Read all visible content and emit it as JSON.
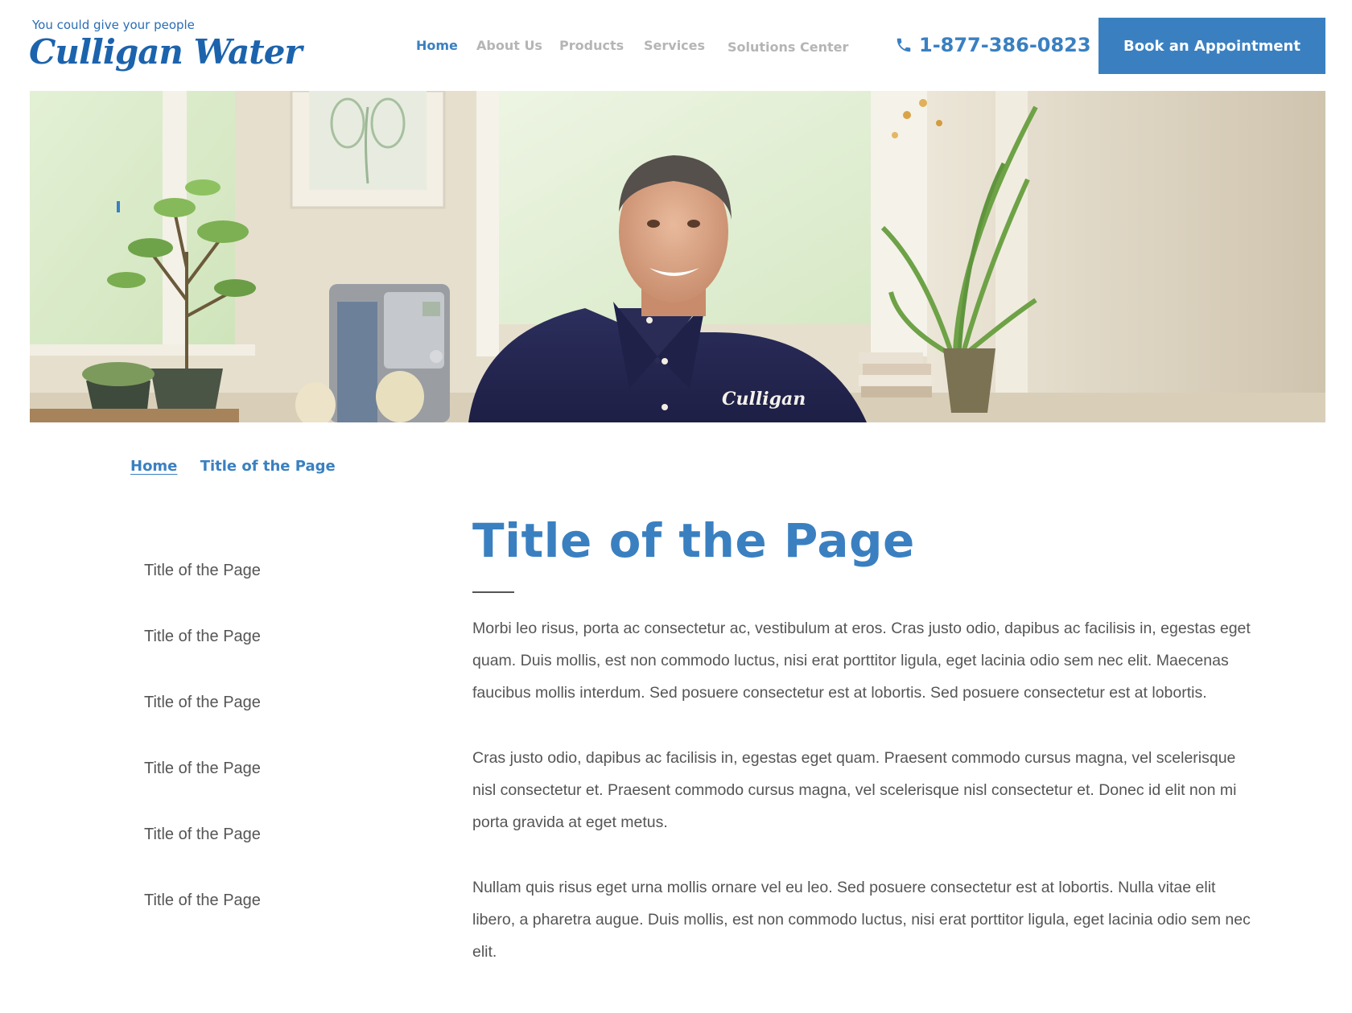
{
  "header": {
    "logo": {
      "tagline": "You could give your people",
      "wordmark": "Culligan Water",
      "trademark": "®"
    },
    "nav": {
      "home": "Home",
      "about": "About Us",
      "products": "Products",
      "services": "Services",
      "solutions": "Solutions Center"
    },
    "phone": "1-877-386-0823",
    "cta_label": "Book an Appointment"
  },
  "hero": {
    "shirt_logo": "Culligan"
  },
  "breadcrumb": {
    "home": "Home",
    "current": "Title of the Page"
  },
  "sidebar": {
    "items": [
      {
        "label": "Title of the Page"
      },
      {
        "label": "Title of the Page"
      },
      {
        "label": "Title of the Page"
      },
      {
        "label": "Title of the Page"
      },
      {
        "label": "Title of the Page"
      },
      {
        "label": "Title of the Page"
      }
    ]
  },
  "main": {
    "title": "Title of the Page",
    "paragraphs": [
      "Morbi leo risus, porta ac consectetur ac, vestibulum at eros. Cras justo odio, dapibus ac facilisis in, egestas eget quam. Duis mollis, est non commodo luctus, nisi erat porttitor ligula, eget lacinia odio sem nec elit. Maecenas faucibus mollis interdum. Sed posuere consectetur est at lobortis. Sed posuere consectetur est at lobortis.",
      "Cras justo odio, dapibus ac facilisis in, egestas eget quam. Praesent commodo cursus magna, vel scelerisque nisl consectetur et. Praesent commodo cursus magna, vel scelerisque nisl consectetur et. Donec id elit non mi porta gravida at eget metus.",
      "Nullam quis risus eget urna mollis ornare vel eu leo. Sed posuere consectetur est at lobortis. Nulla vitae elit libero, a pharetra augue. Duis mollis, est non commodo luctus, nisi erat porttitor ligula, eget lacinia odio sem nec elit."
    ]
  },
  "colors": {
    "brand_blue": "#3a80c1",
    "logo_blue": "#1c63ad",
    "nav_inactive": "#b5b5b5",
    "body_text": "#555555"
  }
}
